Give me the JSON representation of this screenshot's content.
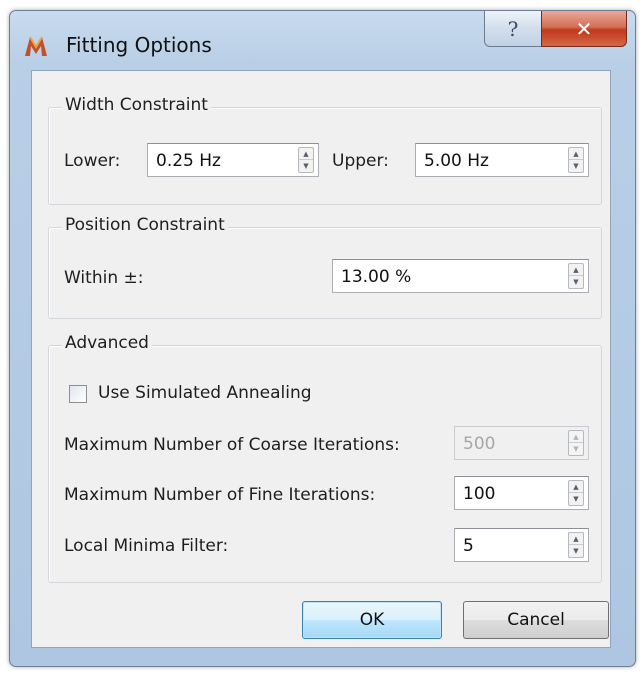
{
  "window": {
    "title": "Fitting Options",
    "help_glyph": "?",
    "close_glyph": "✕"
  },
  "width_constraint": {
    "title": "Width Constraint",
    "lower_label": "Lower:",
    "lower_value": "0.25 Hz",
    "upper_label": "Upper:",
    "upper_value": "5.00 Hz"
  },
  "position_constraint": {
    "title": "Position Constraint",
    "within_label": "Within ±:",
    "within_value": "13.00 %"
  },
  "advanced": {
    "title": "Advanced",
    "annealing_label": "Use Simulated Annealing",
    "annealing_checked": false,
    "coarse_label": "Maximum Number of Coarse Iterations:",
    "coarse_value": "500",
    "coarse_disabled": true,
    "fine_label": "Maximum Number of Fine Iterations:",
    "fine_value": "100",
    "minima_label": "Local Minima Filter:",
    "minima_value": "5"
  },
  "buttons": {
    "ok": "OK",
    "cancel": "Cancel"
  },
  "icons": {
    "app": "m-logo-icon",
    "help": "help-icon",
    "close": "close-icon",
    "spin_up": "arrow-up-icon",
    "spin_down": "arrow-down-icon"
  },
  "colors": {
    "titlebar": "#b9cfe6",
    "close_button": "#c0391b",
    "dialog_bg": "#f0f0f0",
    "default_button": "#bee6fd",
    "app_icon": "#c0512a"
  }
}
